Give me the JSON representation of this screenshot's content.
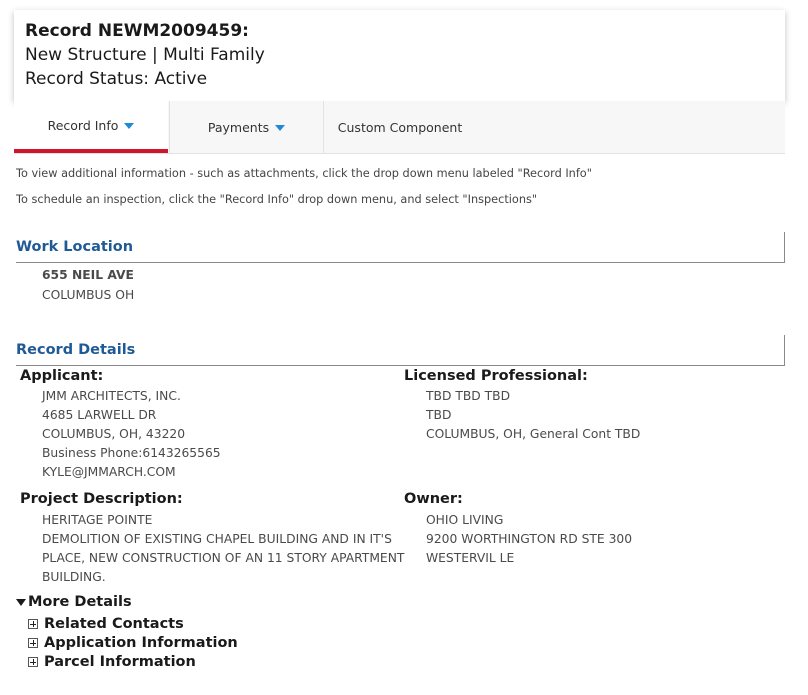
{
  "header": {
    "record_title": "Record NEWM2009459:",
    "record_type": "New Structure | Multi Family",
    "record_status": "Record Status: Active"
  },
  "tabs": [
    {
      "label": "Record Info",
      "has_dropdown": true,
      "active": true
    },
    {
      "label": "Payments",
      "has_dropdown": true,
      "active": false
    },
    {
      "label": "Custom Component",
      "has_dropdown": false,
      "active": false
    }
  ],
  "info": {
    "line1": "To view additional information - such as attachments, click the drop down menu labeled \"Record Info\"",
    "line2": "To schedule an inspection, click the \"Record Info\" drop down menu, and select \"Inspections\""
  },
  "work_location": {
    "title": "Work Location",
    "address_line1": "655 NEIL AVE",
    "address_line2": "COLUMBUS OH"
  },
  "record_details": {
    "title": "Record Details",
    "applicant": {
      "label": "Applicant:",
      "lines": [
        "JMM ARCHITECTS, INC.",
        "4685 LARWELL DR",
        "COLUMBUS, OH, 43220",
        "Business Phone:6143265565",
        "KYLE@JMMARCH.COM"
      ]
    },
    "licensed_professional": {
      "label": "Licensed Professional:",
      "lines": [
        "TBD TBD TBD",
        "TBD",
        "COLUMBUS, OH, General Cont TBD"
      ]
    },
    "project_description": {
      "label": "Project Description:",
      "lines": [
        "HERITAGE POINTE",
        "DEMOLITION OF EXISTING CHAPEL BUILDING AND IN IT'S",
        "PLACE, NEW CONSTRUCTION OF AN 11 STORY APARTMENT",
        "BUILDING."
      ]
    },
    "owner": {
      "label": "Owner:",
      "lines": [
        "OHIO LIVING",
        "9200 WORTHINGTON RD STE 300",
        "WESTERVIL LE"
      ]
    }
  },
  "more_details": {
    "label": "More Details",
    "items": [
      "Related Contacts",
      "Application Information",
      "Parcel Information"
    ]
  },
  "colors": {
    "accent_red": "#d2142a",
    "link_blue": "#1f5a96",
    "caret_blue": "#1e8ad6"
  }
}
